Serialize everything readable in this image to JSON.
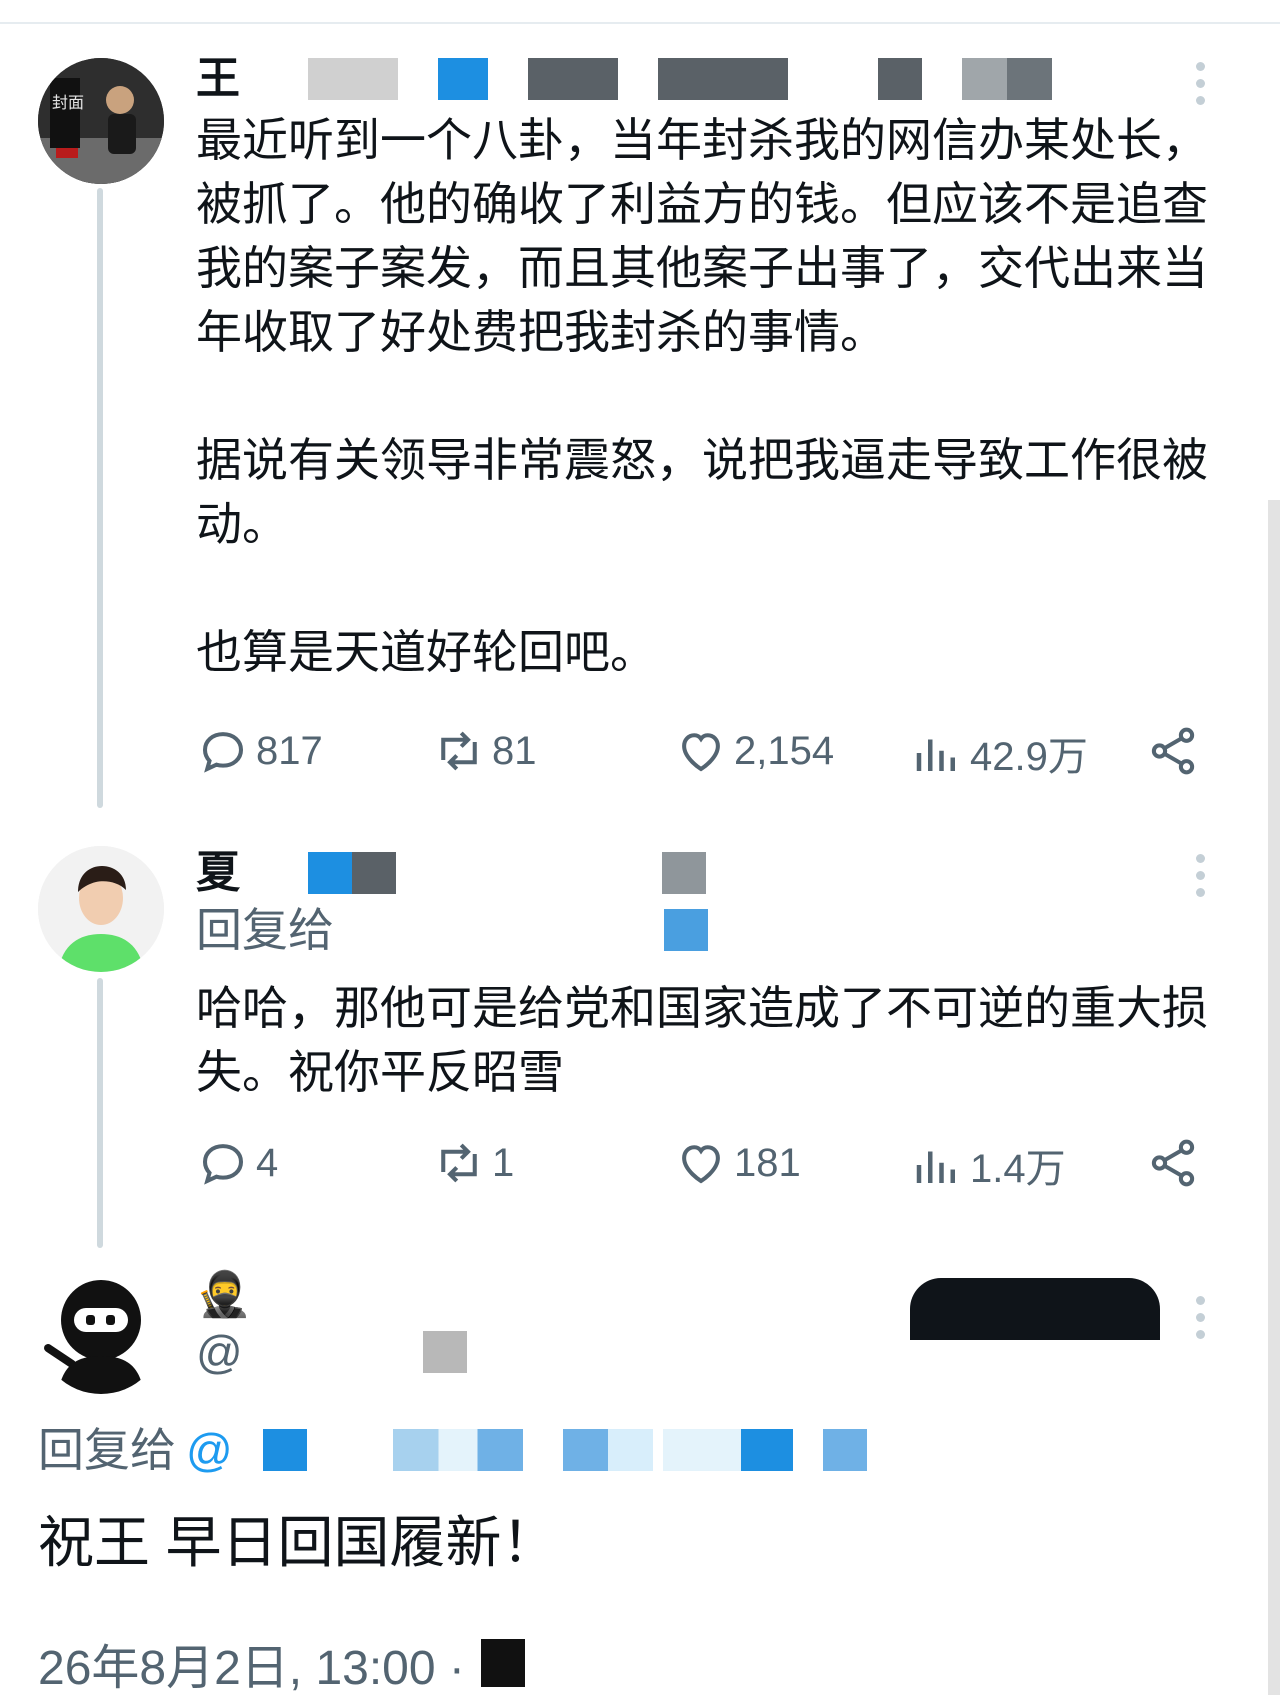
{
  "tweets": [
    {
      "author": {
        "name_visible": "王"
      },
      "text": "最近听到一个八卦，当年封杀我的网信办某处长，被抓了。他的确收了利益方的钱。但应该不是追查我的案子案发，而且其他案子出事了，交代出来当年收取了好处费把我封杀的事情。\n\n据说有关领导非常震怒，说把我逼走导致工作很被动。\n\n也算是天道好轮回吧。",
      "stats": {
        "replies": "817",
        "retweets": "81",
        "likes": "2,154",
        "views": "42.9万"
      }
    },
    {
      "author": {
        "name_visible": "夏"
      },
      "reply_label": "回复给",
      "text": "哈哈，那他可是给党和国家造成了不可逆的重大损失。祝你平反昭雪",
      "stats": {
        "replies": "4",
        "retweets": "1",
        "likes": "181",
        "views": "1.4万"
      }
    },
    {
      "author": {
        "name_visible": "🥷",
        "handle_visible": "@"
      },
      "reply_label": "回复给",
      "reply_handle_visible": "@",
      "text": "祝王 早日回国履新！",
      "timestamp": "26年8月2日, 13:00 ·"
    }
  ],
  "icons": {
    "reply": "reply-icon",
    "retweet": "retweet-icon",
    "like": "heart-icon",
    "views": "views-icon",
    "share": "share-icon",
    "more": "more-icon"
  },
  "colors": {
    "text": "#0f1419",
    "secondary": "#536471",
    "thread_line": "#cfd9de",
    "redact_blue": "#1d8fe1"
  }
}
